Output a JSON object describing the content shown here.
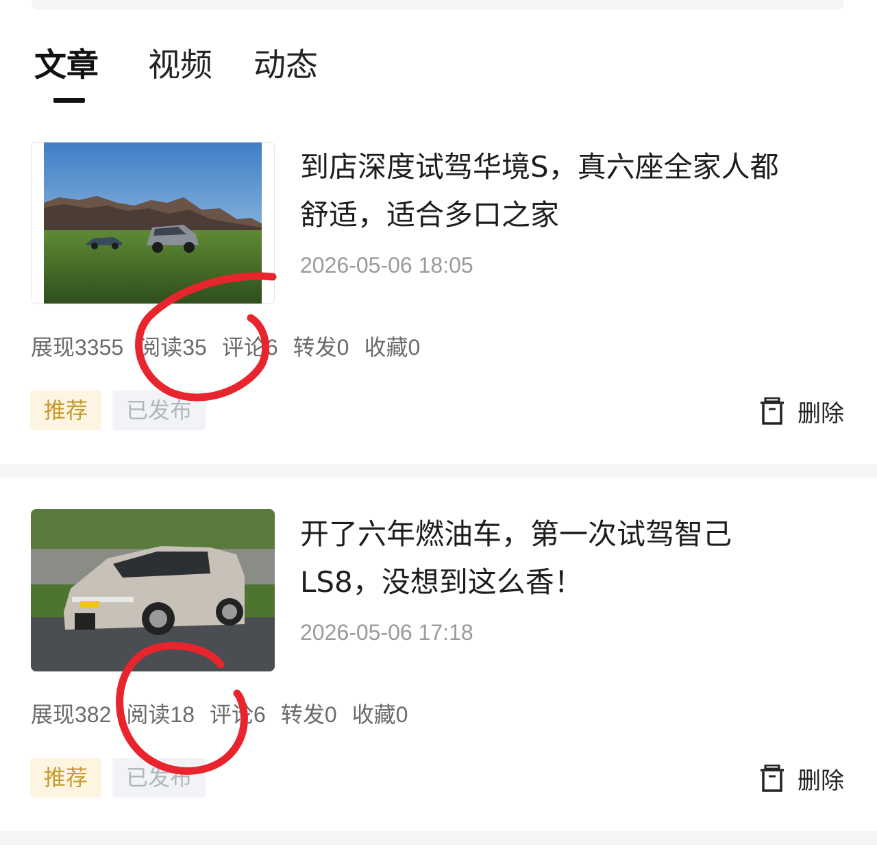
{
  "tabs": [
    {
      "label": "文章",
      "active": true
    },
    {
      "label": "视频",
      "active": false
    },
    {
      "label": "动态",
      "active": false
    }
  ],
  "articles": [
    {
      "title_line1": "到店深度试驾华境S，真六座全家人都",
      "title_line2": "舒适，适合多口之家",
      "date": "2026-05-06 18:05",
      "stats": {
        "impressions": "展现3355",
        "reads": "阅读35",
        "comments": "评论6",
        "shares": "转发0",
        "favorites": "收藏0"
      },
      "badge_recommend": "推荐",
      "badge_status": "已发布",
      "delete_label": "删除"
    },
    {
      "title_line1": "开了六年燃油车，第一次试驾智己",
      "title_line2": "LS8，没想到这么香！",
      "date": "2026-05-06 17:18",
      "stats": {
        "impressions": "展现382",
        "reads": "阅读18",
        "comments": "评论6",
        "shares": "转发0",
        "favorites": "收藏0"
      },
      "badge_recommend": "推荐",
      "badge_status": "已发布",
      "delete_label": "删除"
    }
  ],
  "colors": {
    "annotation": "#e8242c",
    "badge_recommend_text": "#c79a2e",
    "badge_recommend_bg": "#fdf5e1",
    "badge_status_text": "#b3b5bd",
    "separator": "#f4f5f7"
  },
  "icons": {
    "delete": "trash-icon"
  }
}
